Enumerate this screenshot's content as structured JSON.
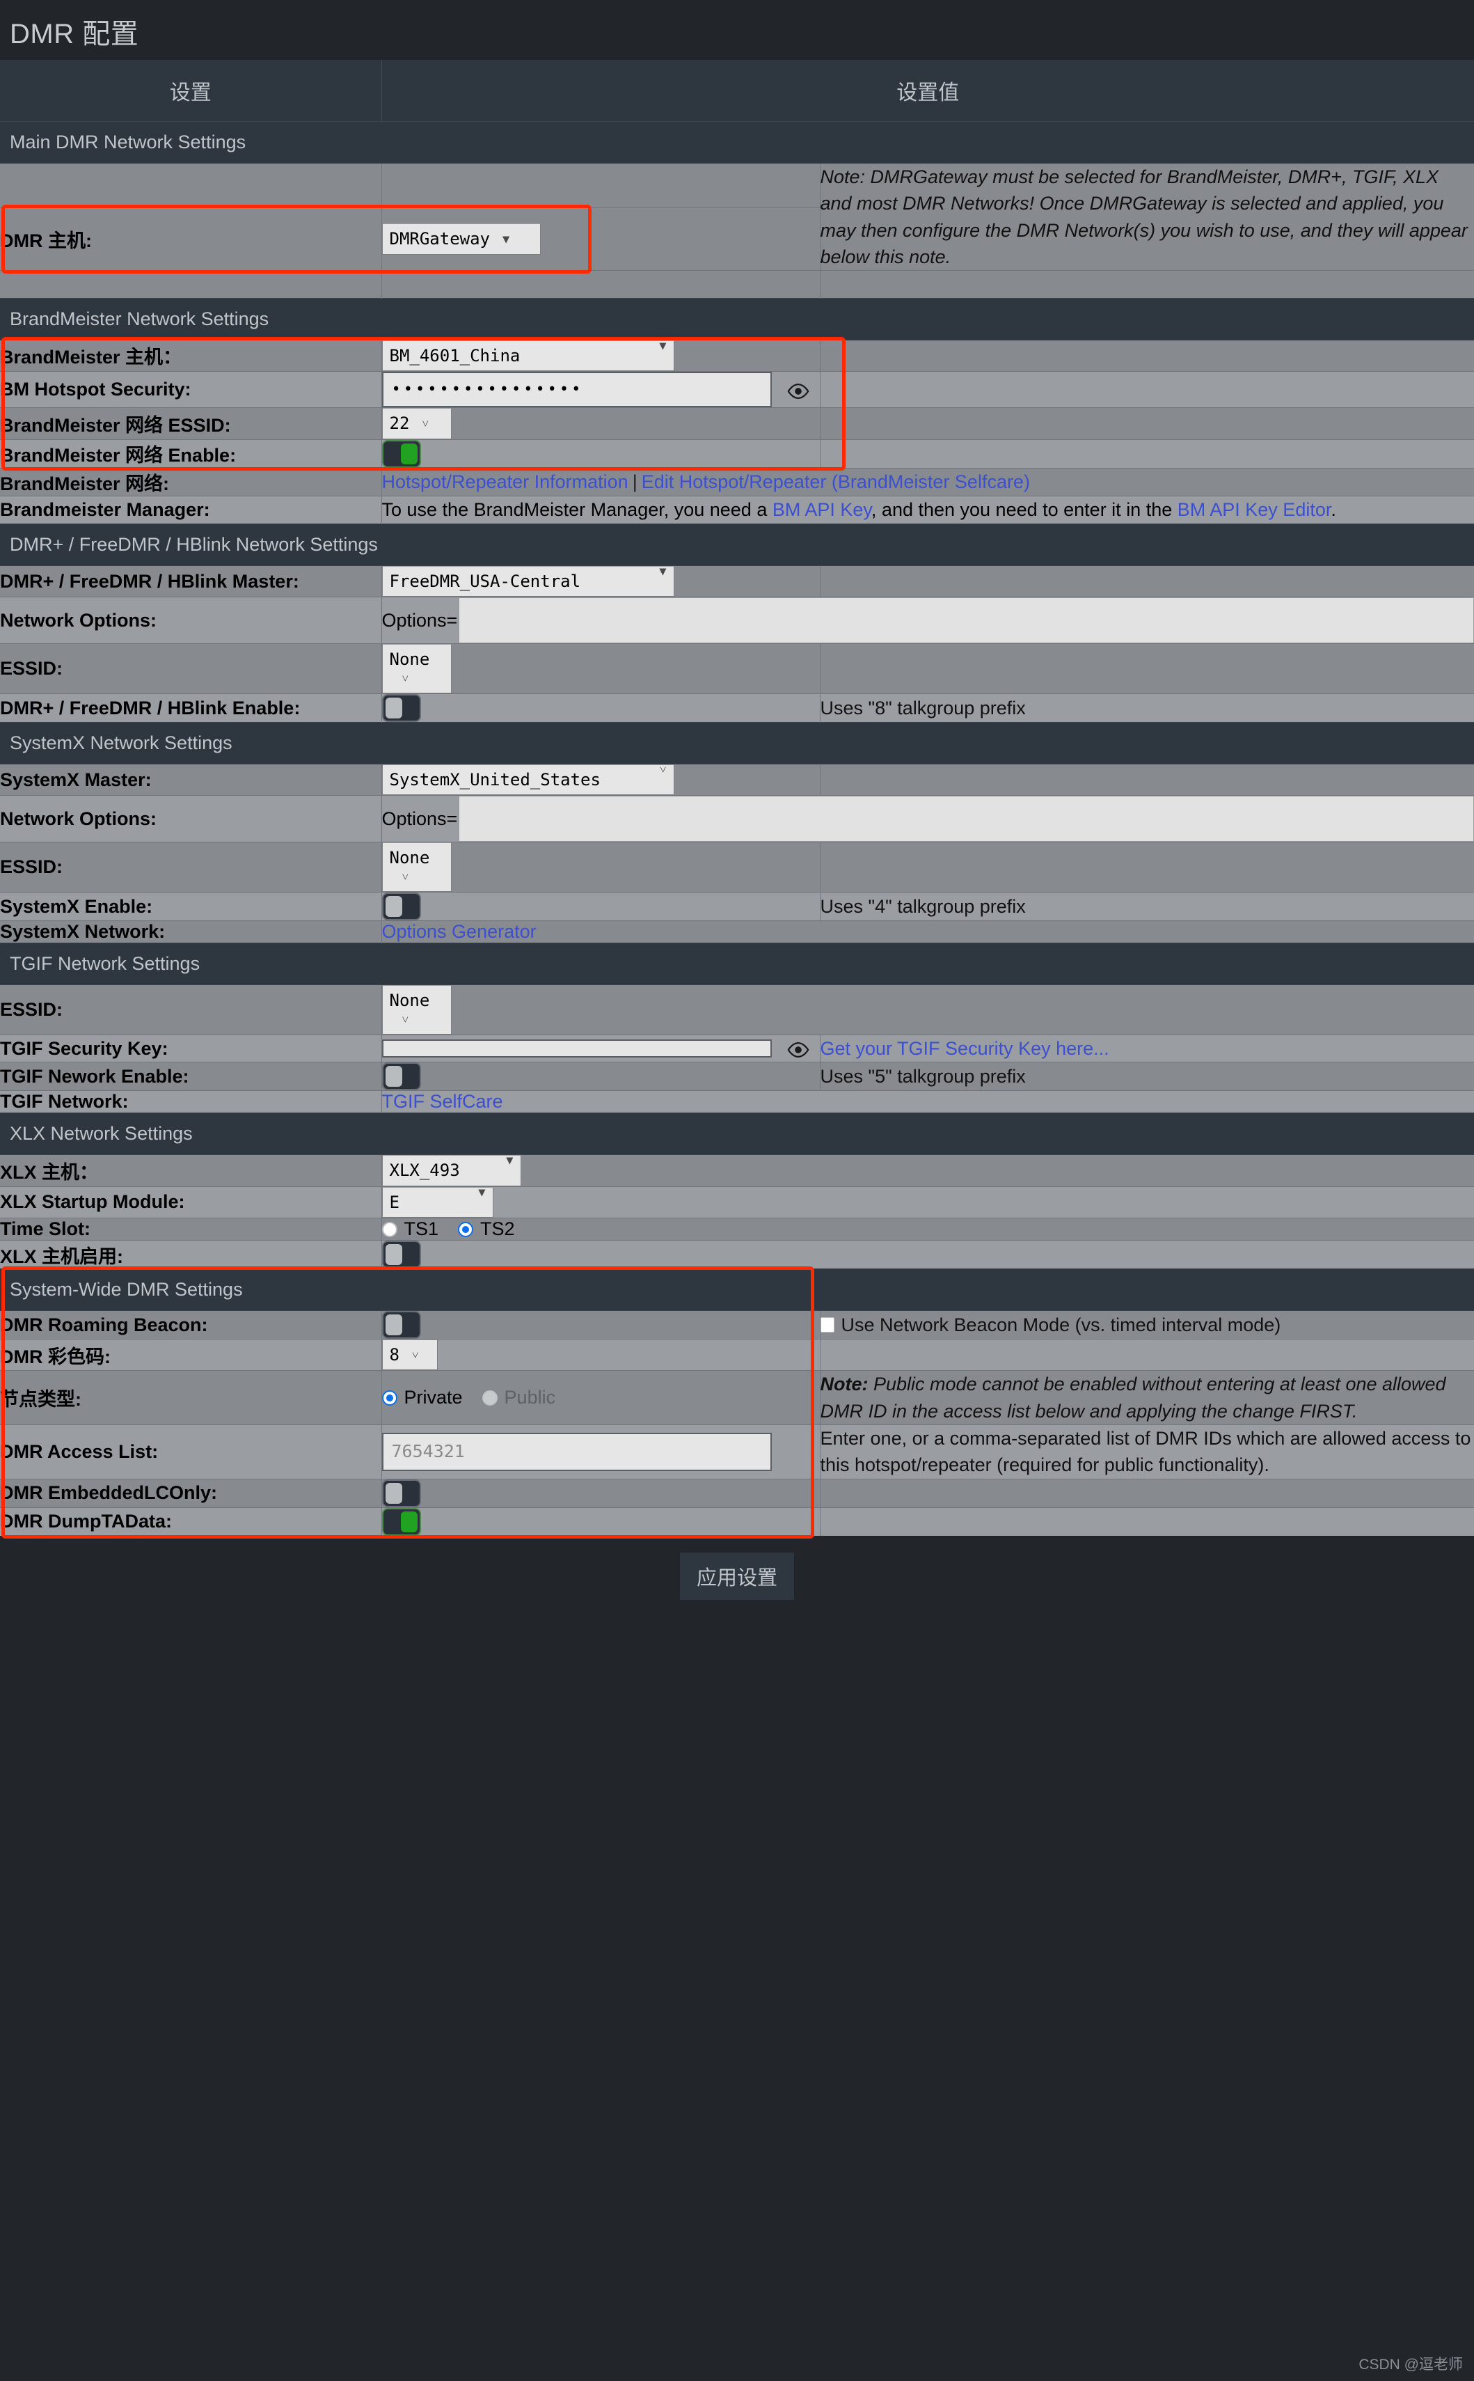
{
  "page": {
    "title": "DMR 配置",
    "watermark": "CSDN @逗老师"
  },
  "table": {
    "col_headers": [
      "设置",
      "设置值"
    ]
  },
  "sections": {
    "main": "Main DMR Network Settings",
    "brandmeister": "BrandMeister Network Settings",
    "dmrplus": "DMR+ / FreeDMR / HBlink Network Settings",
    "systemx": "SystemX Network Settings",
    "tgif": "TGIF Network Settings",
    "xlx": "XLX Network Settings",
    "systemwide": "System-Wide DMR Settings"
  },
  "main": {
    "dmr_master_label": "DMR 主机:",
    "dmr_master_value": "DMRGateway",
    "note": "Note: DMRGateway must be selected for BrandMeister, DMR+, TGIF, XLX and most DMR Networks! Once DMRGateway is selected and applied, you may then configure the DMR Network(s) you wish to use, and they will appear below this note."
  },
  "brandmeister": {
    "master_label": "BrandMeister 主机：",
    "master_value": "BM_4601_China",
    "security_label": "BM Hotspot Security:",
    "security_value": "••••••••••••••••",
    "essid_label": "BrandMeister 网络 ESSID:",
    "essid_value": "22",
    "enable_label": "BrandMeister 网络 Enable:",
    "enable_on": true,
    "network_label": "BrandMeister 网络:",
    "link_hotspot_info": "Hotspot/Repeater Information",
    "link_edit_hotspot": "Edit Hotspot/Repeater (BrandMeister Selfcare)",
    "manager_label": "Brandmeister Manager:",
    "manager_text_1": "To use the BrandMeister Manager, you need a ",
    "manager_link_1": "BM API Key",
    "manager_text_2": ", and then you need to enter it in the ",
    "manager_link_2": "BM API Key Editor",
    "manager_text_3": "."
  },
  "dmrplus": {
    "master_label": "DMR+ / FreeDMR / HBlink Master:",
    "master_value": "FreeDMR_USA-Central",
    "options_label": "Network Options:",
    "options_prefix": "Options=",
    "options_value": "",
    "essid_label": "ESSID:",
    "essid_value": "None",
    "enable_label": "DMR+ / FreeDMR / HBlink Enable:",
    "enable_on": false,
    "enable_note": "Uses \"8\" talkgroup prefix"
  },
  "systemx": {
    "master_label": "SystemX Master:",
    "master_value": "SystemX_United_States",
    "options_label": "Network Options:",
    "options_prefix": "Options=",
    "options_value": "",
    "essid_label": "ESSID:",
    "essid_value": "None",
    "enable_label": "SystemX Enable:",
    "enable_on": false,
    "enable_note": "Uses \"4\" talkgroup prefix",
    "network_label": "SystemX Network:",
    "network_link": "Options Generator"
  },
  "tgif": {
    "essid_label": "ESSID:",
    "essid_value": "None",
    "seckey_label": "TGIF Security Key:",
    "seckey_value": "",
    "seckey_link": "Get your TGIF Security Key here...",
    "enable_label": "TGIF Nework Enable:",
    "enable_on": false,
    "enable_note": "Uses \"5\" talkgroup prefix",
    "network_label": "TGIF Network:",
    "network_link": "TGIF SelfCare"
  },
  "xlx": {
    "master_label": "XLX 主机：",
    "master_value": "XLX_493",
    "module_label": "XLX Startup Module:",
    "module_value": "E",
    "timeslot_label": "Time Slot:",
    "timeslot_options": [
      "TS1",
      "TS2"
    ],
    "timeslot_selected": "TS2",
    "enable_label": "XLX 主机启用:",
    "enable_on": false
  },
  "systemwide": {
    "beacon_label": "DMR Roaming Beacon:",
    "beacon_on": false,
    "beacon_checkbox_label": "Use Network Beacon Mode (vs. timed interval mode)",
    "beacon_checkbox_checked": false,
    "colorcode_label": "DMR 彩色码:",
    "colorcode_value": "8",
    "nodetype_label": "节点类型:",
    "nodetype_options": [
      "Private",
      "Public"
    ],
    "nodetype_selected": "Private",
    "nodetype_note_bold": "Note:",
    "nodetype_note": " Public mode cannot be enabled without entering at least one allowed DMR ID in the access list below and applying the change FIRST.",
    "acl_label": "DMR Access List:",
    "acl_placeholder": "7654321",
    "acl_note": "Enter one, or a comma-separated list of DMR IDs which are allowed access to this hotspot/repeater (required for public functionality).",
    "embedded_label": "DMR EmbeddedLCOnly:",
    "embedded_on": false,
    "dumpta_label": "DMR DumpTAData:",
    "dumpta_on": true
  },
  "footer": {
    "apply_label": "应用设置"
  },
  "colors": {
    "accent_red": "#ff2a00",
    "link_blue": "#3c4fd0",
    "toggle_green": "#21a321",
    "header_bg": "#2e3640",
    "row_dark": "#878b8f",
    "row_light": "#9a9da1",
    "page_bg": "#22262b"
  }
}
